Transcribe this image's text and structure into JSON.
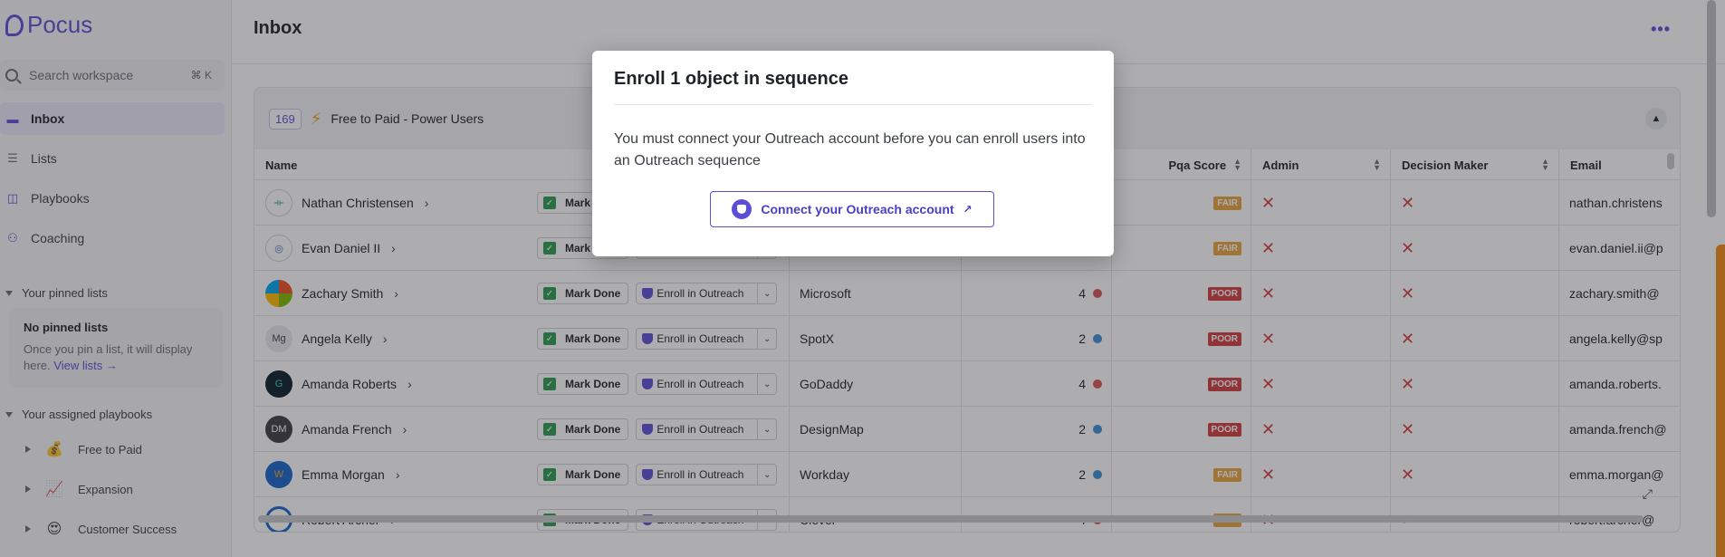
{
  "app": {
    "logo_text": "Pocus"
  },
  "sidebar": {
    "search_placeholder": "Search workspace",
    "search_shortcut": "⌘ K",
    "nav": [
      {
        "label": "Inbox",
        "icon": "inbox-icon"
      },
      {
        "label": "Lists",
        "icon": "list-icon"
      },
      {
        "label": "Playbooks",
        "icon": "book-icon"
      },
      {
        "label": "Coaching",
        "icon": "people-icon"
      }
    ],
    "pinned_header": "Your pinned lists",
    "pinned_empty_title": "No pinned lists",
    "pinned_empty_desc": "Once you pin a list, it will display here.",
    "pinned_link": "View lists →",
    "playbooks_header": "Your assigned playbooks",
    "playbooks": [
      {
        "label": "Free to Paid",
        "emoji": "💰"
      },
      {
        "label": "Expansion",
        "emoji": "📈"
      },
      {
        "label": "Customer Success",
        "emoji": "😍"
      }
    ]
  },
  "main": {
    "title": "Inbox",
    "card": {
      "count": "169",
      "title": "Free to Paid - Power Users",
      "columns": {
        "name": "Name",
        "pqa": "Pqa Score",
        "admin": "Admin",
        "decision": "Decision Maker",
        "email": "Email"
      },
      "mark_done_label": "Mark Done",
      "enroll_label": "Enroll in Outreach",
      "rows": [
        {
          "name": "Nathan Christensen",
          "company": "",
          "score": "",
          "pqa": "FAIR",
          "email": "nathan.christens"
        },
        {
          "name": "Evan Daniel II",
          "company": "",
          "score": "",
          "pqa": "FAIR",
          "email": "evan.daniel.ii@p"
        },
        {
          "name": "Zachary Smith",
          "company": "Microsoft",
          "score": "4",
          "pqa": "POOR",
          "email": "zachary.smith@"
        },
        {
          "name": "Angela Kelly",
          "company": "SpotX",
          "score": "2",
          "pqa": "POOR",
          "email": "angela.kelly@sp"
        },
        {
          "name": "Amanda Roberts",
          "company": "GoDaddy",
          "score": "4",
          "pqa": "POOR",
          "email": "amanda.roberts."
        },
        {
          "name": "Amanda French",
          "company": "DesignMap",
          "score": "2",
          "pqa": "POOR",
          "email": "amanda.french@"
        },
        {
          "name": "Emma Morgan",
          "company": "Workday",
          "score": "2",
          "pqa": "FAIR",
          "email": "emma.morgan@"
        },
        {
          "name": "Robert Archer",
          "company": "Clever",
          "score": "4",
          "pqa": "FAIR",
          "email": "robert.archer@"
        }
      ]
    }
  },
  "modal": {
    "title": "Enroll 1 object in sequence",
    "body": "You must connect your Outreach account before you can enroll users into an Outreach sequence",
    "button": "Connect your Outreach account"
  },
  "colors": {
    "brand": "#5b4fd6",
    "poor": "#d23c3c",
    "fair": "#e8a33d",
    "success": "#2d9c4f"
  }
}
